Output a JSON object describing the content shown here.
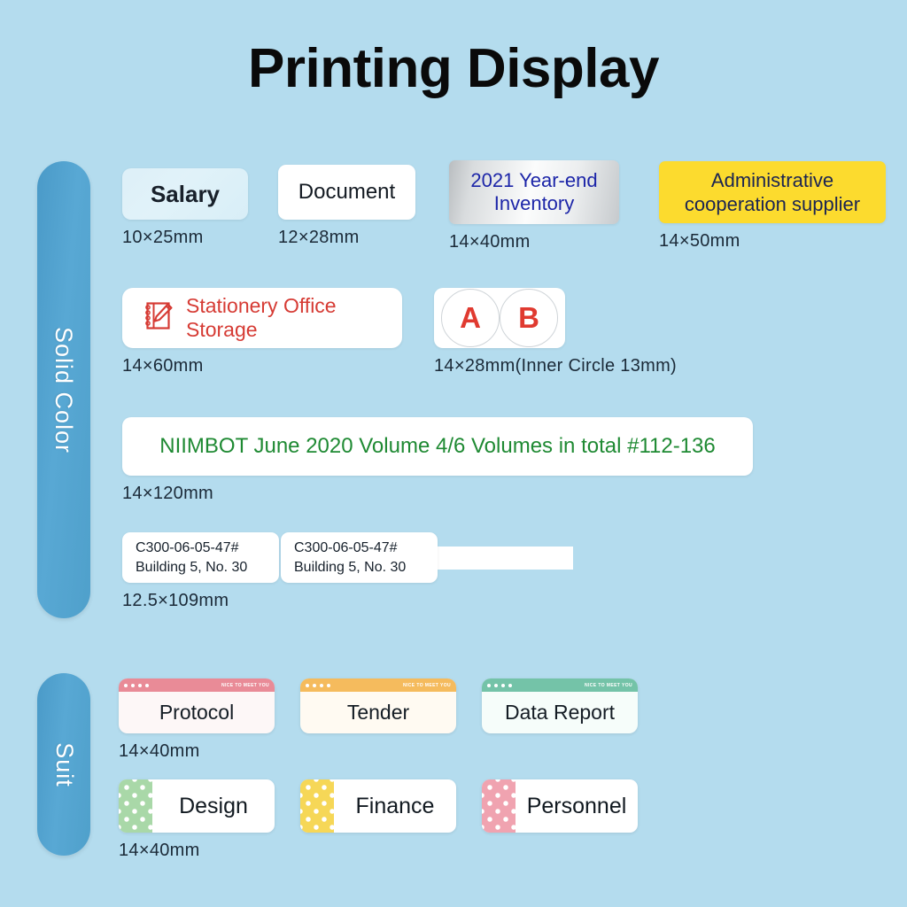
{
  "page": {
    "title": "Printing Display",
    "background_color": "#b4dcee"
  },
  "sections": [
    {
      "id": "solid-color",
      "tab_label": "Solid Color",
      "tab_color": "#4fa0cb"
    },
    {
      "id": "suit",
      "tab_label": "Suit",
      "tab_color": "#4fa0cb"
    }
  ],
  "solid_color": {
    "row1": [
      {
        "name": "salary",
        "text": "Salary",
        "dim": "10×25mm",
        "style": "frosted",
        "text_color": "#18202a"
      },
      {
        "name": "document",
        "text": "Document",
        "dim": "12×28mm",
        "style": "white",
        "text_color": "#131a22"
      },
      {
        "name": "inventory",
        "line1": "2021 Year-end",
        "line2": "Inventory",
        "dim": "14×40mm",
        "style": "silver",
        "text_color": "#1c25a8"
      },
      {
        "name": "administrative",
        "line1": "Administrative",
        "line2": "cooperation supplier",
        "dim": "14×50mm",
        "style": "yellow",
        "bg_color": "#fcdb2e",
        "text_color": "#1b2452"
      }
    ],
    "row2": [
      {
        "name": "stationery",
        "icon": "notebook-pencil-icon",
        "text": "Stationery Office Storage",
        "dim": "14×60mm",
        "text_color": "#d63b34"
      },
      {
        "name": "ab-circles",
        "circle_a": "A",
        "circle_b": "B",
        "dim": "14×28mm(Inner Circle  13mm)",
        "text_color": "#e03a30"
      }
    ],
    "row3": {
      "name": "niimbot",
      "text": "NIIMBOT June 2020 Volume 4/6 Volumes in total #112-136",
      "dim": "14×120mm",
      "text_color": "#1f8a33"
    },
    "row4": {
      "name": "c300-cable",
      "labels": [
        {
          "line1": "C300-06-05-47#",
          "line2": "Building 5, No. 30"
        },
        {
          "line1": "C300-06-05-47#",
          "line2": "Building 5, No. 30"
        }
      ],
      "dim": "12.5×109mm"
    }
  },
  "suit": {
    "row1": {
      "dim": "14×40mm",
      "cards": [
        {
          "name": "protocol",
          "text": "Protocol",
          "bar_color": "#e98b97",
          "bar_tag": "NICE TO MEET YOU",
          "body_color": "#fdf7f7"
        },
        {
          "name": "tender",
          "text": "Tender",
          "bar_color": "#f5bb5d",
          "bar_tag": "NICE TO MEET YOU",
          "body_color": "#fffaf2"
        },
        {
          "name": "data-report",
          "text": "Data Report",
          "bar_color": "#74c3a8",
          "bar_tag": "NICE TO MEET YOU",
          "body_color": "#f6fdfa"
        }
      ]
    },
    "row2": {
      "dim": "14×40mm",
      "cards": [
        {
          "name": "design",
          "text": "Design",
          "strip_color": "#a9d8a8"
        },
        {
          "name": "finance",
          "text": "Finance",
          "strip_color": "#f6d757"
        },
        {
          "name": "personnel",
          "text": "Personnel",
          "strip_color": "#f0a3b0"
        }
      ]
    }
  }
}
